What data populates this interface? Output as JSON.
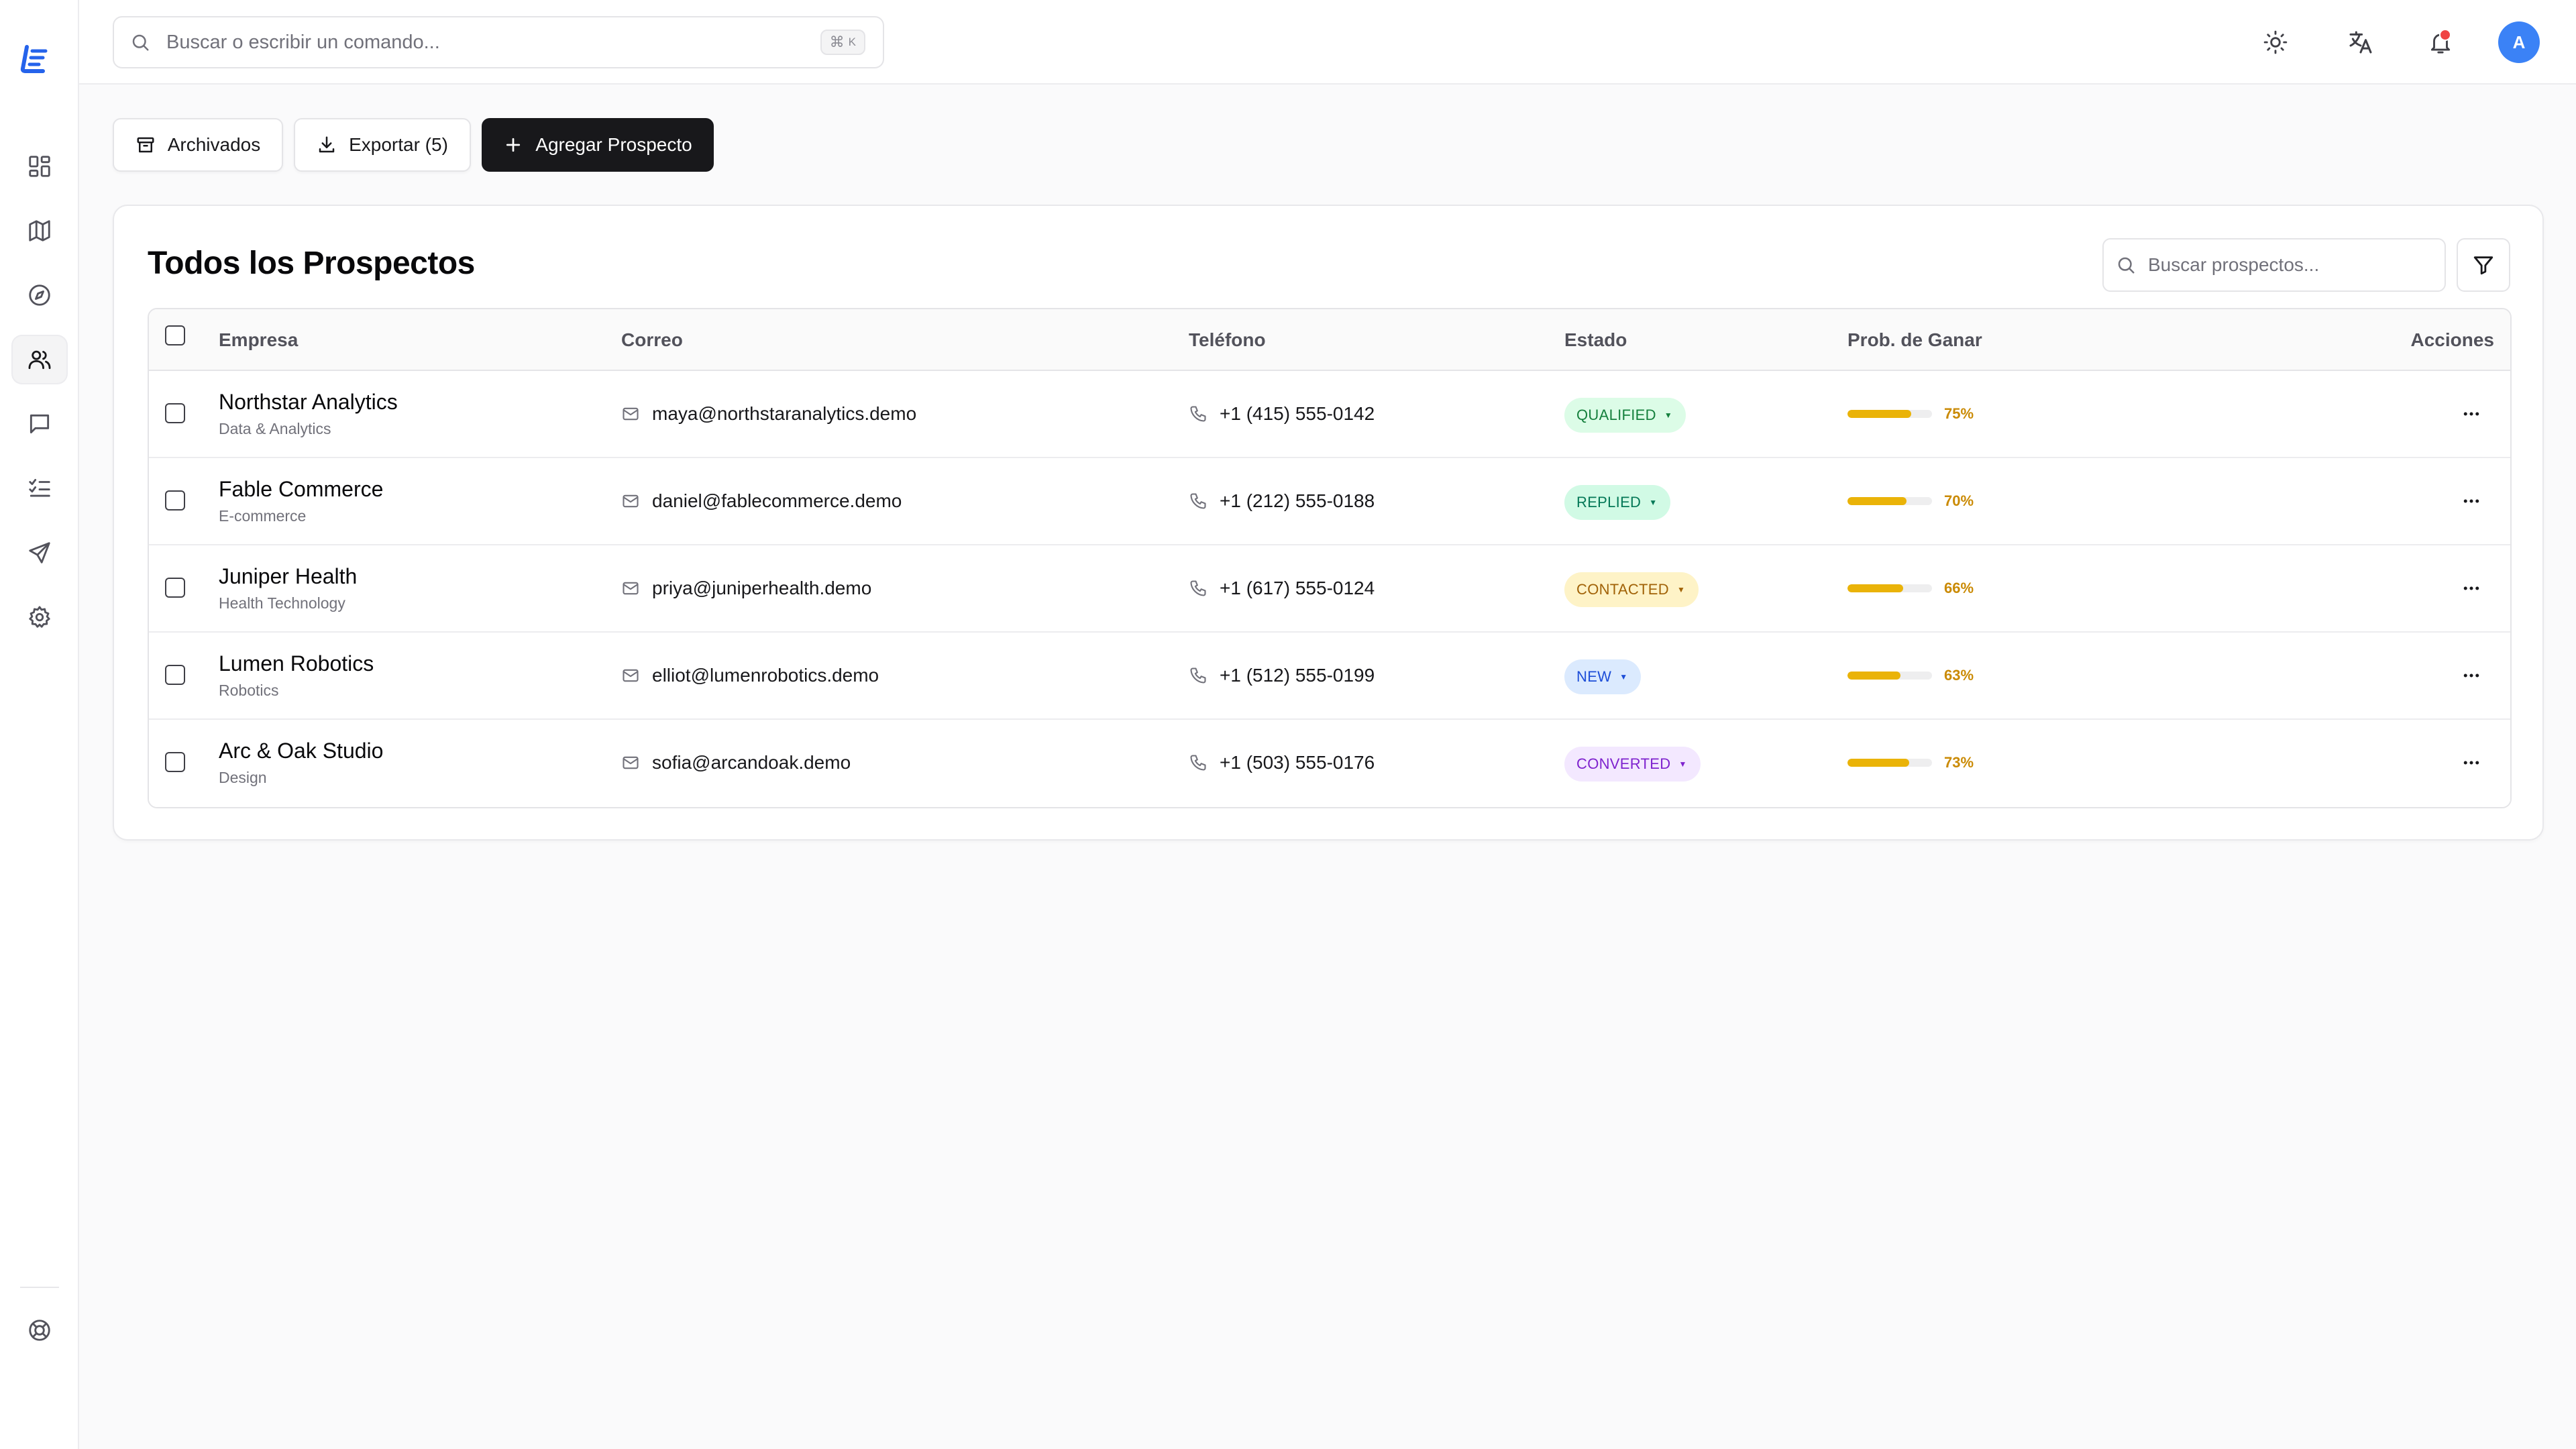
{
  "app": {
    "logo_icon": "leads-logo-icon",
    "accent": "#2563eb"
  },
  "search": {
    "placeholder": "Buscar o escribir un comando...",
    "shortcut_symbol": "⌘",
    "shortcut_key": "K"
  },
  "sidebar": {
    "items": [
      {
        "name": "dashboard",
        "icon": "dashboard-icon",
        "active": false
      },
      {
        "name": "map",
        "icon": "map-icon",
        "active": false
      },
      {
        "name": "explore",
        "icon": "compass-icon",
        "active": false
      },
      {
        "name": "prospects",
        "icon": "users-icon",
        "active": true
      },
      {
        "name": "messages",
        "icon": "message-icon",
        "active": false
      },
      {
        "name": "tasks",
        "icon": "checklist-icon",
        "active": false
      },
      {
        "name": "campaigns",
        "icon": "send-icon",
        "active": false
      },
      {
        "name": "settings",
        "icon": "gear-icon",
        "active": false
      }
    ],
    "help_icon": "lifebuoy-icon"
  },
  "topbar": {
    "theme_icon": "sun-icon",
    "language_icon": "translate-icon",
    "notifications_icon": "bell-icon",
    "notification_dot_color": "#ef4444",
    "avatar_initial": "A",
    "avatar_color": "#3b82f6"
  },
  "toolbar": {
    "archived_label": "Archivados",
    "export_label": "Exportar (5)",
    "add_label": "Agregar Prospecto"
  },
  "card": {
    "title": "Todos los Prospectos",
    "search_placeholder": "Buscar prospectos..."
  },
  "table": {
    "headers": {
      "company": "Empresa",
      "email": "Correo",
      "phone": "Teléfono",
      "status": "Estado",
      "win": "Prob. de Ganar",
      "actions": "Acciones"
    },
    "rows": [
      {
        "name": "Northstar Analytics",
        "industry": "Data & Analytics",
        "email": "maya@northstaranalytics.demo",
        "phone": "+1 (415) 555-0142",
        "status": "QUALIFIED",
        "status_bg": "#dcfce7",
        "status_fg": "#15803d",
        "win_pct": 75,
        "win_label": "75%"
      },
      {
        "name": "Fable Commerce",
        "industry": "E-commerce",
        "email": "daniel@fablecommerce.demo",
        "phone": "+1 (212) 555-0188",
        "status": "REPLIED",
        "status_bg": "#d1fae5",
        "status_fg": "#047857",
        "win_pct": 70,
        "win_label": "70%"
      },
      {
        "name": "Juniper Health",
        "industry": "Health Technology",
        "email": "priya@juniperhealth.demo",
        "phone": "+1 (617) 555-0124",
        "status": "CONTACTED",
        "status_bg": "#fef3c7",
        "status_fg": "#a16207",
        "win_pct": 66,
        "win_label": "66%"
      },
      {
        "name": "Lumen Robotics",
        "industry": "Robotics",
        "email": "elliot@lumenrobotics.demo",
        "phone": "+1 (512) 555-0199",
        "status": "NEW",
        "status_bg": "#dbeafe",
        "status_fg": "#1d4ed8",
        "win_pct": 63,
        "win_label": "63%"
      },
      {
        "name": "Arc & Oak Studio",
        "industry": "Design",
        "email": "sofia@arcandoak.demo",
        "phone": "+1 (503) 555-0176",
        "status": "CONVERTED",
        "status_bg": "#f3e8ff",
        "status_fg": "#7e22ce",
        "win_pct": 73,
        "win_label": "73%"
      }
    ]
  }
}
